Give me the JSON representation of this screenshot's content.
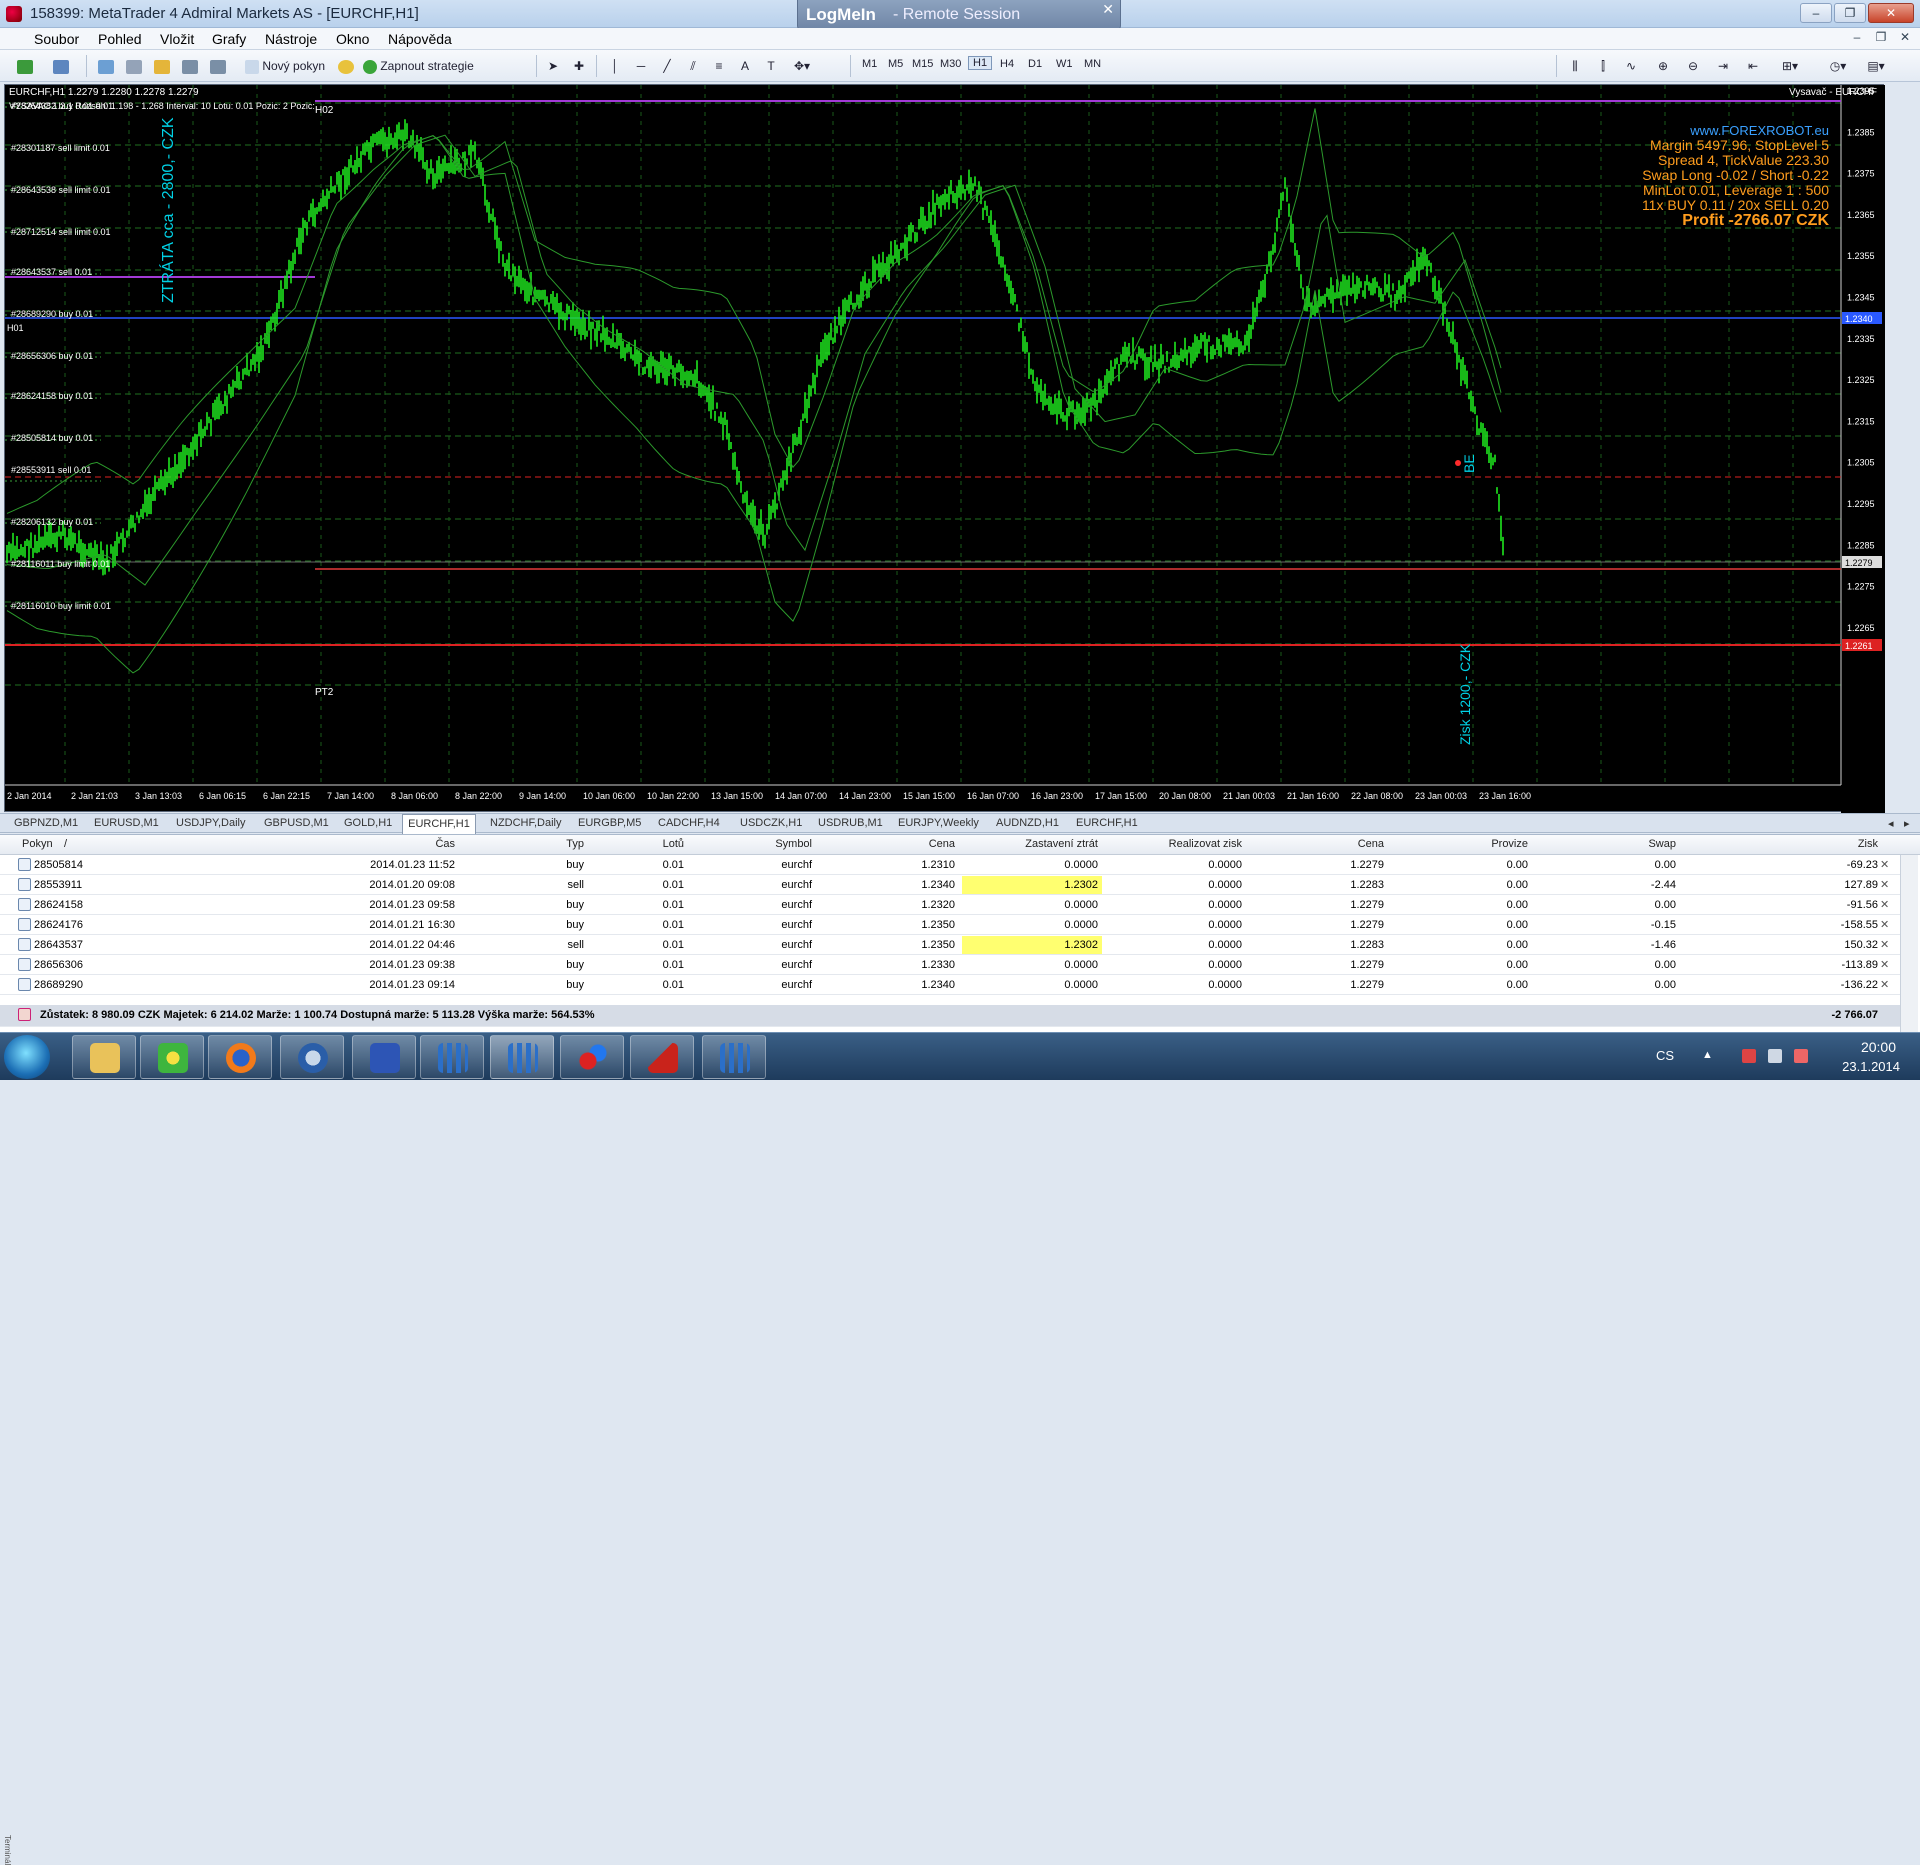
{
  "window": {
    "title": "158399: MetaTrader 4 Admiral Markets AS - [EURCHF,H1]"
  },
  "logmein": {
    "brand": "LogMeIn",
    "subtitle": "- Remote Session"
  },
  "menu": [
    "Soubor",
    "Pohled",
    "Vložit",
    "Grafy",
    "Nástroje",
    "Okno",
    "Nápověda"
  ],
  "toolbar": {
    "new_order": "Nový pokyn",
    "autotrade": "Zapnout strategie",
    "timeframes": [
      "M1",
      "M5",
      "M15",
      "M30",
      "H1",
      "H4",
      "D1",
      "W1",
      "MN"
    ],
    "active_tf": "H1"
  },
  "chart": {
    "header": "EURCHF,H1  1.2279 1.2280 1.2278 1.2279",
    "header2": "VYSAVAC 1.2.1  Rozsah: 1.198 - 1.268  Interval: 10  Lotu: 0.01  Pozic: 2  Pozic:",
    "vysavac_label": "Vysavač - EURCHF",
    "info": {
      "site": "www.FOREXROBOT.eu",
      "margin": "Margin 5497.96, StopLevel 5",
      "spread": "Spread 4, TickValue 223.30",
      "swap": "Swap Long -0.02 / Short -0.22",
      "minlot": "MinLot 0.01, Leverage 1 : 500",
      "buysell": "11x BUY 0.11 / 20x SELL 0.20",
      "profit": "Profit -2766.07 CZK"
    },
    "annotations": {
      "loss": "ZTRÁTA cca - 2800,- CZK",
      "gain": "Zisk 1200,- CZK",
      "be": "BE",
      "pt2": "PT2",
      "h02": "H02",
      "h01": "H01"
    },
    "order_labels": [
      "#28254382 buy 0.01 0.01",
      "#28301187 sell limit 0.01",
      "#28643538 sell limit 0.01",
      "#28712514 sell limit 0.01",
      "#28643537 sell 0.01",
      "#28689290 buy 0.01",
      "#28656306 buy 0.01",
      "#28624158 buy 0.01",
      "#28505814 buy 0.01",
      "#28553911 sell 0.01",
      "#28206132 buy 0.01",
      "#28116011 buy limit 0.01",
      "#28116010 buy limit 0.01"
    ],
    "price_labels": [
      "1.2395",
      "1.2385",
      "1.2375",
      "1.2365",
      "1.2355",
      "1.2345",
      "1.2335",
      "1.2325",
      "1.2315",
      "1.2305",
      "1.2295",
      "1.2285",
      "1.2275",
      "1.2265"
    ],
    "price_tags": {
      "blue": "1.2340",
      "current": "1.2279",
      "red": "1.2261"
    },
    "time_labels": [
      "2 Jan 2014",
      "2 Jan 21:03",
      "3 Jan 13:03",
      "6 Jan 06:15",
      "6 Jan 22:15",
      "7 Jan 14:00",
      "8 Jan 06:00",
      "8 Jan 22:00",
      "9 Jan 14:00",
      "10 Jan 06:00",
      "10 Jan 22:00",
      "13 Jan 15:00",
      "14 Jan 07:00",
      "14 Jan 23:00",
      "15 Jan 15:00",
      "16 Jan 07:00",
      "16 Jan 23:00",
      "17 Jan 15:00",
      "20 Jan 08:00",
      "21 Jan 00:03",
      "21 Jan 16:00",
      "22 Jan 08:00",
      "23 Jan 00:03",
      "23 Jan 16:00"
    ]
  },
  "chart_tabs": [
    "GBPNZD,M1",
    "EURUSD,M1",
    "USDJPY,Daily",
    "GBPUSD,M1",
    "GOLD,H1",
    "EURCHF,H1",
    "NZDCHF,Daily",
    "EURGBP,M5",
    "CADCHF,H4",
    "USDCZK,H1",
    "USDRUB,M1",
    "EURJPY,Weekly",
    "AUDNZD,H1",
    "EURCHF,H1"
  ],
  "terminal": {
    "columns": [
      "Pokyn",
      "Čas",
      "Typ",
      "Lotů",
      "Symbol",
      "Cena",
      "Zastavení ztrát",
      "Realizovat zisk",
      "Cena",
      "Provize",
      "Swap",
      "Zisk"
    ],
    "sort_marker": "/",
    "rows": [
      {
        "id": "28505814",
        "time": "2014.01.23 11:52",
        "type": "buy",
        "lots": "0.01",
        "symbol": "eurchf",
        "price": "1.2310",
        "sl": "0.0000",
        "tp": "0.0000",
        "cur": "1.2279",
        "comm": "0.00",
        "swap": "0.00",
        "profit": "-69.23",
        "hl": false
      },
      {
        "id": "28553911",
        "time": "2014.01.20 09:08",
        "type": "sell",
        "lots": "0.01",
        "symbol": "eurchf",
        "price": "1.2340",
        "sl": "1.2302",
        "tp": "0.0000",
        "cur": "1.2283",
        "comm": "0.00",
        "swap": "-2.44",
        "profit": "127.89",
        "hl": true
      },
      {
        "id": "28624158",
        "time": "2014.01.23 09:58",
        "type": "buy",
        "lots": "0.01",
        "symbol": "eurchf",
        "price": "1.2320",
        "sl": "0.0000",
        "tp": "0.0000",
        "cur": "1.2279",
        "comm": "0.00",
        "swap": "0.00",
        "profit": "-91.56",
        "hl": false
      },
      {
        "id": "28624176",
        "time": "2014.01.21 16:30",
        "type": "buy",
        "lots": "0.01",
        "symbol": "eurchf",
        "price": "1.2350",
        "sl": "0.0000",
        "tp": "0.0000",
        "cur": "1.2279",
        "comm": "0.00",
        "swap": "-0.15",
        "profit": "-158.55",
        "hl": false
      },
      {
        "id": "28643537",
        "time": "2014.01.22 04:46",
        "type": "sell",
        "lots": "0.01",
        "symbol": "eurchf",
        "price": "1.2350",
        "sl": "1.2302",
        "tp": "0.0000",
        "cur": "1.2283",
        "comm": "0.00",
        "swap": "-1.46",
        "profit": "150.32",
        "hl": true
      },
      {
        "id": "28656306",
        "time": "2014.01.23 09:38",
        "type": "buy",
        "lots": "0.01",
        "symbol": "eurchf",
        "price": "1.2330",
        "sl": "0.0000",
        "tp": "0.0000",
        "cur": "1.2279",
        "comm": "0.00",
        "swap": "0.00",
        "profit": "-113.89",
        "hl": false
      },
      {
        "id": "28689290",
        "time": "2014.01.23 09:14",
        "type": "buy",
        "lots": "0.01",
        "symbol": "eurchf",
        "price": "1.2340",
        "sl": "0.0000",
        "tp": "0.0000",
        "cur": "1.2279",
        "comm": "0.00",
        "swap": "0.00",
        "profit": "-136.22",
        "hl": false
      }
    ],
    "balance": "Zůstatek: 8 980.09 CZK  Majetek: 6 214.02  Marže: 1 100.74  Dostupná marže: 5 113.28  Výška marže: 564.53%",
    "balance_total": "-2 766.07",
    "side": "Terminál"
  },
  "taskbar": {
    "lang": "CS",
    "time": "20:00",
    "date": "23.1.2014"
  }
}
